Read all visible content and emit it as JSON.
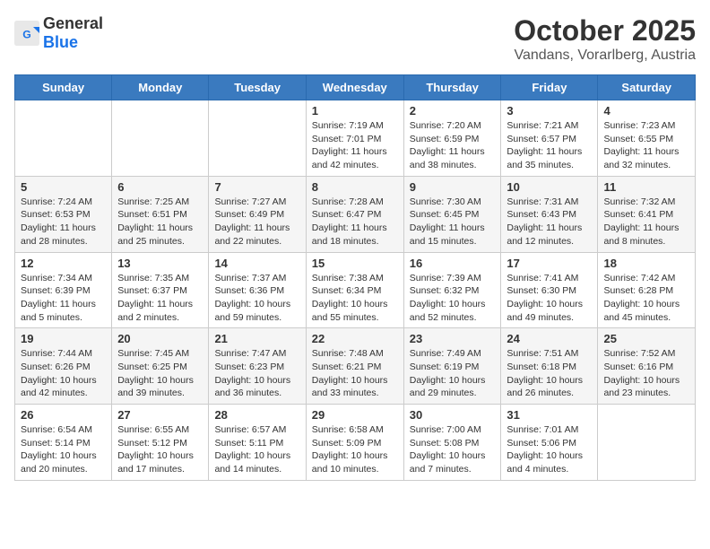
{
  "header": {
    "logo_general": "General",
    "logo_blue": "Blue",
    "month": "October 2025",
    "location": "Vandans, Vorarlberg, Austria"
  },
  "days_of_week": [
    "Sunday",
    "Monday",
    "Tuesday",
    "Wednesday",
    "Thursday",
    "Friday",
    "Saturday"
  ],
  "weeks": [
    [
      {
        "day": "",
        "info": ""
      },
      {
        "day": "",
        "info": ""
      },
      {
        "day": "",
        "info": ""
      },
      {
        "day": "1",
        "info": "Sunrise: 7:19 AM\nSunset: 7:01 PM\nDaylight: 11 hours and 42 minutes."
      },
      {
        "day": "2",
        "info": "Sunrise: 7:20 AM\nSunset: 6:59 PM\nDaylight: 11 hours and 38 minutes."
      },
      {
        "day": "3",
        "info": "Sunrise: 7:21 AM\nSunset: 6:57 PM\nDaylight: 11 hours and 35 minutes."
      },
      {
        "day": "4",
        "info": "Sunrise: 7:23 AM\nSunset: 6:55 PM\nDaylight: 11 hours and 32 minutes."
      }
    ],
    [
      {
        "day": "5",
        "info": "Sunrise: 7:24 AM\nSunset: 6:53 PM\nDaylight: 11 hours and 28 minutes."
      },
      {
        "day": "6",
        "info": "Sunrise: 7:25 AM\nSunset: 6:51 PM\nDaylight: 11 hours and 25 minutes."
      },
      {
        "day": "7",
        "info": "Sunrise: 7:27 AM\nSunset: 6:49 PM\nDaylight: 11 hours and 22 minutes."
      },
      {
        "day": "8",
        "info": "Sunrise: 7:28 AM\nSunset: 6:47 PM\nDaylight: 11 hours and 18 minutes."
      },
      {
        "day": "9",
        "info": "Sunrise: 7:30 AM\nSunset: 6:45 PM\nDaylight: 11 hours and 15 minutes."
      },
      {
        "day": "10",
        "info": "Sunrise: 7:31 AM\nSunset: 6:43 PM\nDaylight: 11 hours and 12 minutes."
      },
      {
        "day": "11",
        "info": "Sunrise: 7:32 AM\nSunset: 6:41 PM\nDaylight: 11 hours and 8 minutes."
      }
    ],
    [
      {
        "day": "12",
        "info": "Sunrise: 7:34 AM\nSunset: 6:39 PM\nDaylight: 11 hours and 5 minutes."
      },
      {
        "day": "13",
        "info": "Sunrise: 7:35 AM\nSunset: 6:37 PM\nDaylight: 11 hours and 2 minutes."
      },
      {
        "day": "14",
        "info": "Sunrise: 7:37 AM\nSunset: 6:36 PM\nDaylight: 10 hours and 59 minutes."
      },
      {
        "day": "15",
        "info": "Sunrise: 7:38 AM\nSunset: 6:34 PM\nDaylight: 10 hours and 55 minutes."
      },
      {
        "day": "16",
        "info": "Sunrise: 7:39 AM\nSunset: 6:32 PM\nDaylight: 10 hours and 52 minutes."
      },
      {
        "day": "17",
        "info": "Sunrise: 7:41 AM\nSunset: 6:30 PM\nDaylight: 10 hours and 49 minutes."
      },
      {
        "day": "18",
        "info": "Sunrise: 7:42 AM\nSunset: 6:28 PM\nDaylight: 10 hours and 45 minutes."
      }
    ],
    [
      {
        "day": "19",
        "info": "Sunrise: 7:44 AM\nSunset: 6:26 PM\nDaylight: 10 hours and 42 minutes."
      },
      {
        "day": "20",
        "info": "Sunrise: 7:45 AM\nSunset: 6:25 PM\nDaylight: 10 hours and 39 minutes."
      },
      {
        "day": "21",
        "info": "Sunrise: 7:47 AM\nSunset: 6:23 PM\nDaylight: 10 hours and 36 minutes."
      },
      {
        "day": "22",
        "info": "Sunrise: 7:48 AM\nSunset: 6:21 PM\nDaylight: 10 hours and 33 minutes."
      },
      {
        "day": "23",
        "info": "Sunrise: 7:49 AM\nSunset: 6:19 PM\nDaylight: 10 hours and 29 minutes."
      },
      {
        "day": "24",
        "info": "Sunrise: 7:51 AM\nSunset: 6:18 PM\nDaylight: 10 hours and 26 minutes."
      },
      {
        "day": "25",
        "info": "Sunrise: 7:52 AM\nSunset: 6:16 PM\nDaylight: 10 hours and 23 minutes."
      }
    ],
    [
      {
        "day": "26",
        "info": "Sunrise: 6:54 AM\nSunset: 5:14 PM\nDaylight: 10 hours and 20 minutes."
      },
      {
        "day": "27",
        "info": "Sunrise: 6:55 AM\nSunset: 5:12 PM\nDaylight: 10 hours and 17 minutes."
      },
      {
        "day": "28",
        "info": "Sunrise: 6:57 AM\nSunset: 5:11 PM\nDaylight: 10 hours and 14 minutes."
      },
      {
        "day": "29",
        "info": "Sunrise: 6:58 AM\nSunset: 5:09 PM\nDaylight: 10 hours and 10 minutes."
      },
      {
        "day": "30",
        "info": "Sunrise: 7:00 AM\nSunset: 5:08 PM\nDaylight: 10 hours and 7 minutes."
      },
      {
        "day": "31",
        "info": "Sunrise: 7:01 AM\nSunset: 5:06 PM\nDaylight: 10 hours and 4 minutes."
      },
      {
        "day": "",
        "info": ""
      }
    ]
  ]
}
